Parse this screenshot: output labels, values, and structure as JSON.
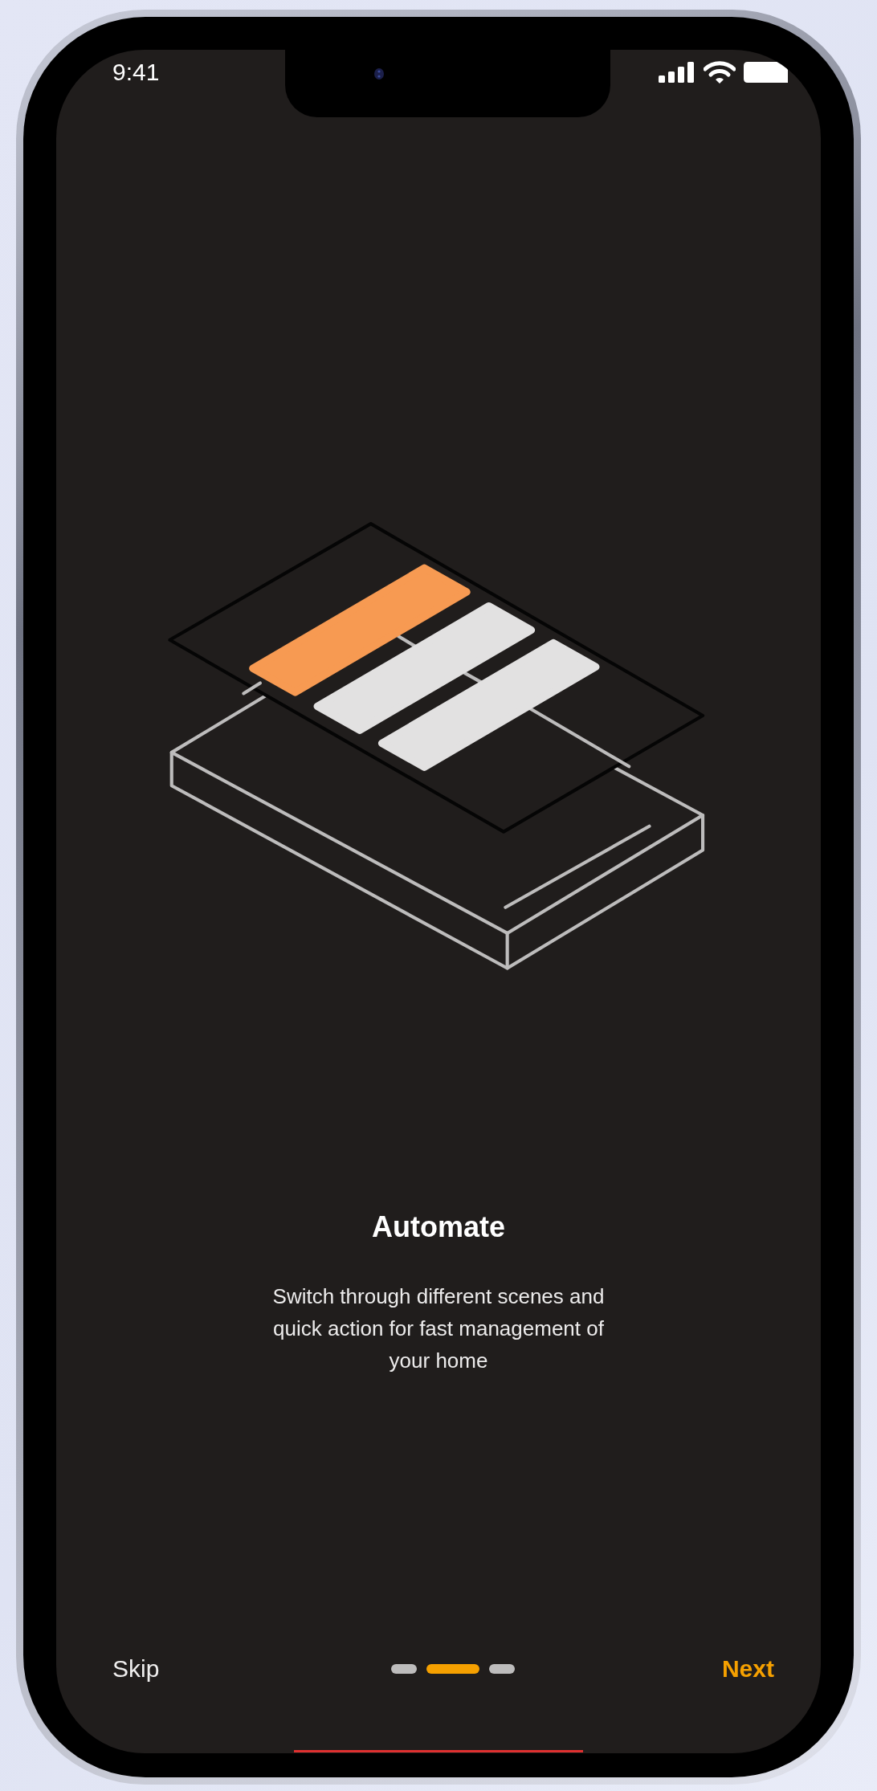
{
  "status_bar": {
    "time": "9:41"
  },
  "slide": {
    "title": "Automate",
    "description": "Switch through different scenes and quick action for fast management of your home"
  },
  "footer": {
    "skip": "Skip",
    "next": "Next",
    "pages": [
      {
        "selected": false
      },
      {
        "selected": true
      },
      {
        "selected": false
      }
    ]
  }
}
